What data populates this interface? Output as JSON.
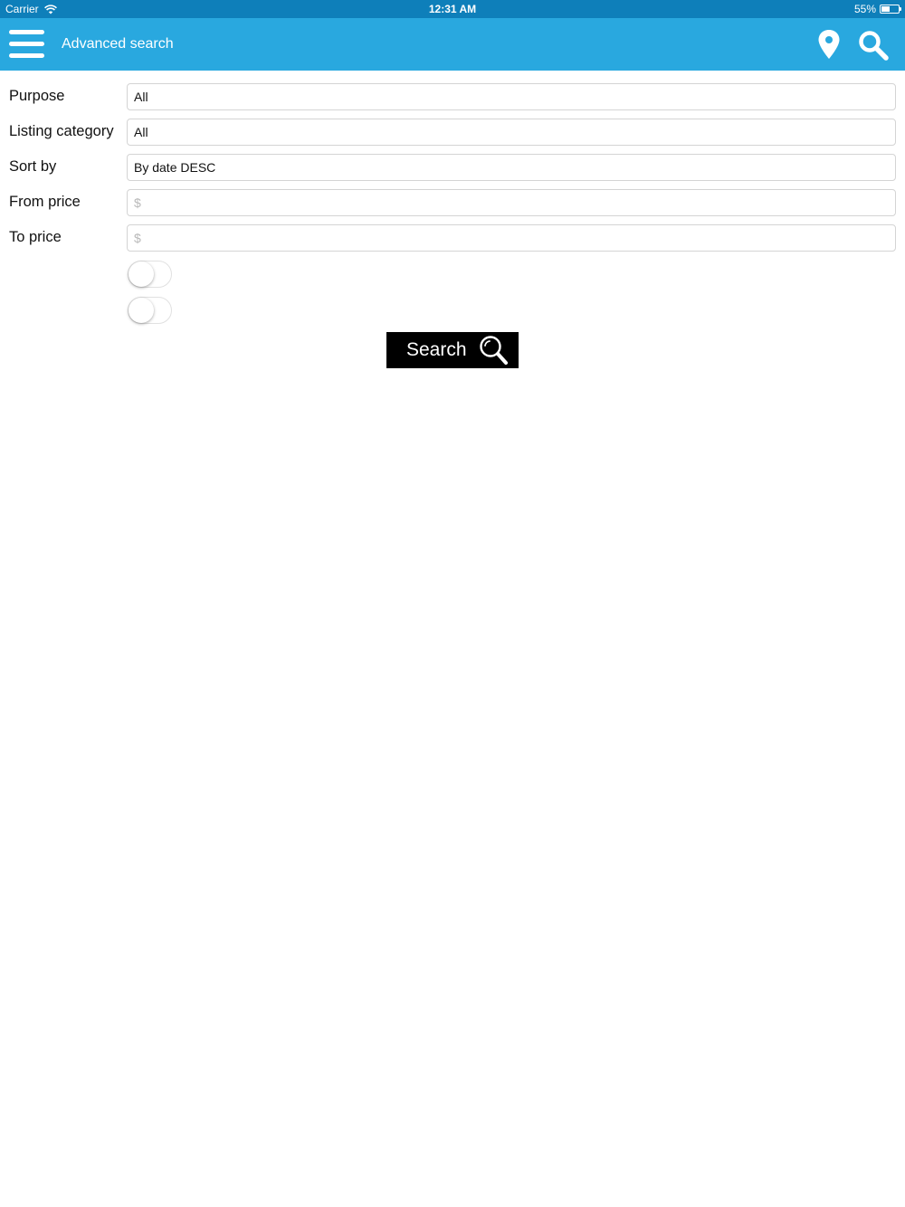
{
  "status_bar": {
    "carrier": "Carrier",
    "time": "12:31 AM",
    "battery_percent": "55%",
    "battery_level": 0.55
  },
  "nav_bar": {
    "title": "Advanced search",
    "background_color": "#29a8df",
    "icons": [
      "menu-icon",
      "map-pin-icon",
      "search-icon"
    ]
  },
  "form": {
    "fields": [
      {
        "label": "Purpose",
        "value": "All"
      },
      {
        "label": "Listing category",
        "value": "All"
      },
      {
        "label": "Sort by",
        "value": "By date DESC"
      },
      {
        "label": "From price",
        "value": "",
        "placeholder": "$"
      },
      {
        "label": "To price",
        "value": "",
        "placeholder": "$"
      }
    ],
    "toggles": [
      {
        "on": false
      },
      {
        "on": false
      }
    ],
    "search_button_label": "Search"
  }
}
